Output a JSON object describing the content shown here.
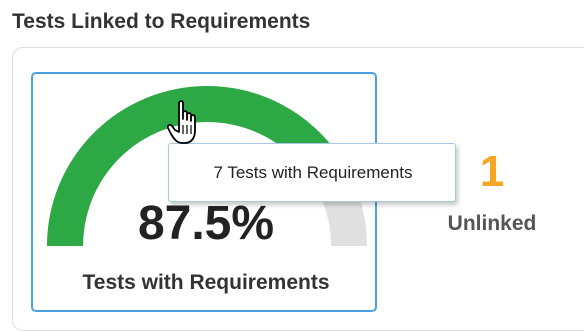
{
  "section": {
    "title": "Tests Linked to Requirements"
  },
  "gauge": {
    "value_percent": 87.5,
    "percent_label": "87.5%",
    "caption": "Tests with Requirements",
    "fill_color": "#2ca844",
    "track_color": "#e0e0e0",
    "border_color": "#4aa3df"
  },
  "unlinked": {
    "count": "1",
    "label": "Unlinked",
    "color": "#f5a623"
  },
  "tooltip": {
    "text": "7 Tests with Requirements"
  },
  "cursor": {
    "icon": "hand-pointer-icon"
  }
}
